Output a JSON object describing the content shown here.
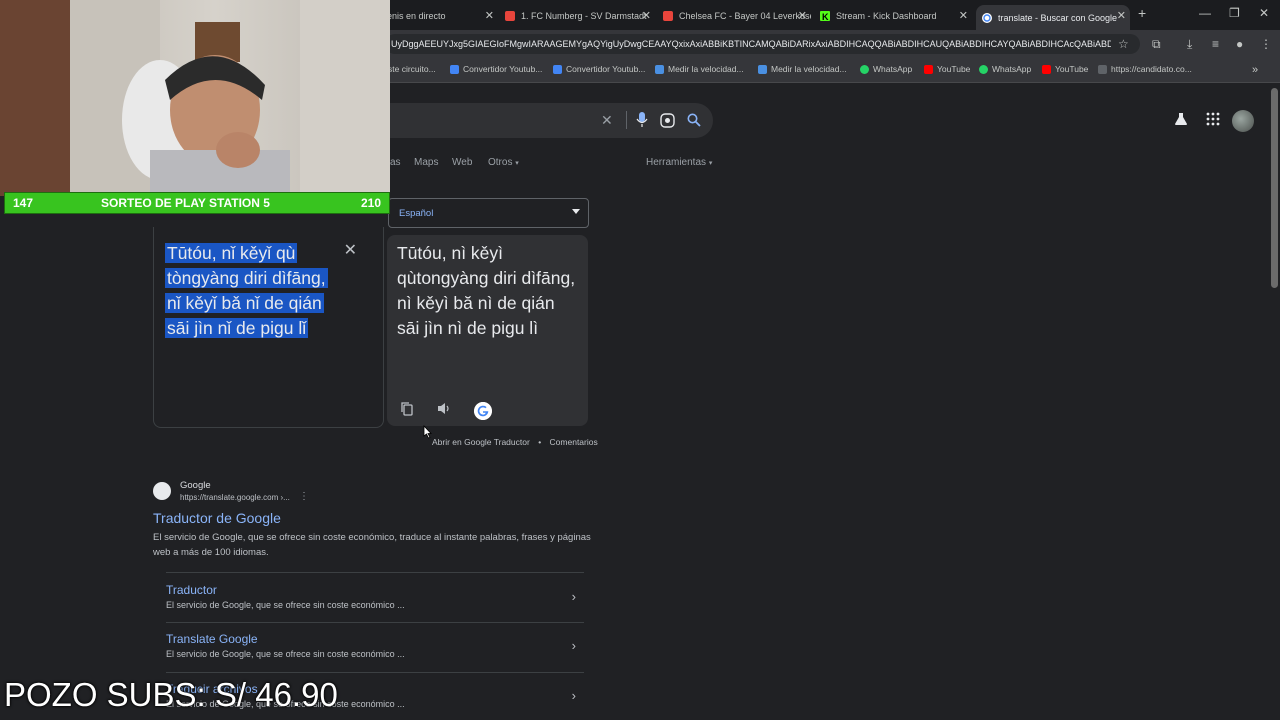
{
  "tabs": [
    {
      "label": "ados de tenis en directo",
      "icon": "live-scores-icon",
      "color": "#8ab4f8"
    },
    {
      "label": "1. FC Numberg - SV Darmstadt",
      "icon": "betting-site-icon",
      "color": "#e8453c"
    },
    {
      "label": "Chelsea FC - Bayer 04 Leverkusen",
      "icon": "betting-site-icon",
      "color": "#e8453c"
    },
    {
      "label": "Stream - Kick Dashboard",
      "icon": "kick-icon",
      "color": "#53fc18"
    },
    {
      "label": "translate - Buscar con Google",
      "icon": "google-icon",
      "active": true
    }
  ],
  "toolbar": {
    "url": "UyDggAEEUYJxg5GIAEGIoFMgwIARAAGEMYgAQYigUyDwgCEAAYQxixAxiABBiKBTINCAMQABiDARixAxiABDIHCAQQABiABDIHCAUQABiABDIHCAYQABiABDIHCAcQABiABDIHC..."
  },
  "bookmarks": [
    {
      "label": "ste circuito...",
      "color": "#5f6368"
    },
    {
      "label": "Convertidor Youtub...",
      "color": "#4285f4"
    },
    {
      "label": "Convertidor Youtub...",
      "color": "#4285f4"
    },
    {
      "label": "Medir la velocidad...",
      "color": "#4a90e2"
    },
    {
      "label": "Medir la velocidad...",
      "color": "#4a90e2"
    },
    {
      "label": "WhatsApp",
      "color": "#25d366"
    },
    {
      "label": "YouTube",
      "color": "#ff0000"
    },
    {
      "label": "WhatsApp",
      "color": "#25d366"
    },
    {
      "label": "YouTube",
      "color": "#ff0000"
    },
    {
      "label": "https://candidato.co...",
      "color": "#5f6368"
    }
  ],
  "nav": {
    "partial": "as",
    "maps": "Maps",
    "web": "Web",
    "otros": "Otros",
    "herramientas": "Herramientas"
  },
  "translate": {
    "target_lang": "Español",
    "source_text": "Tūtóu, nǐ kěyǐ qù tòngyàng diri dìfāng, nǐ kěyǐ bǎ nǐ de qián sāi jìn nǐ de pigu lǐ",
    "target_text": "Tūtóu, nì kěyì qùtongyàng diri dìfāng, nì kěyì bă nì de qián sāi jìn nì de pigu lì",
    "open_link": "Abrir en Google Traductor",
    "dot": "•",
    "feedback": "Comentarios"
  },
  "result": {
    "site": "Google",
    "url": "https://translate.google.com ›...",
    "title": "Traductor de Google",
    "snippet": "El servicio de Google, que se ofrece sin coste económico, traduce al instante palabras, frases y páginas web a más de 100 idiomas.",
    "sublinks": [
      {
        "title": "Traductor",
        "desc": "El servicio de Google, que se ofrece sin coste económico ..."
      },
      {
        "title": "Translate Google",
        "desc": "El servicio de Google, que se ofrece sin coste económico ..."
      },
      {
        "title": "Traducir archivos",
        "desc": "El servicio de Google, que se ofrece sin coste económico ..."
      }
    ]
  },
  "overlay": {
    "banner_left": "147",
    "banner_center": "SORTEO DE PLAY STATION 5",
    "banner_right": "210",
    "pozo": "POZO SUBS: S/ 46.90"
  }
}
